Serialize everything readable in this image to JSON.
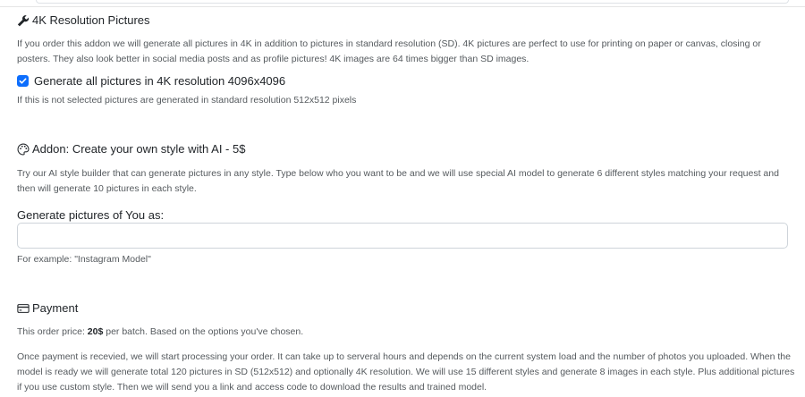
{
  "sections": {
    "hd4k": {
      "title": "4K Resolution Pictures",
      "icon": "wrench-icon",
      "description": "If you order this addon we will generate all pictures in 4K in addition to pictures in standard resolution (SD). 4K pictures are perfect to use for printing on paper or canvas, closing or posters. They also look better in social media posts and as profile pictures! 4K images are 64 times bigger than SD images.",
      "checkbox_label": "Generate all pictures in 4K resolution 4096x4096",
      "checkbox_checked": true,
      "hint": "If this is not selected pictures are generated in standard resolution 512x512 pixels"
    },
    "custom_style": {
      "title": "Addon: Create your own style with AI - 5$",
      "icon": "palette-icon",
      "description": "Try our AI style builder that can generate pictures in any style. Type below who you want to be and we will use special AI model to generate 6 different styles matching your request and then will generate 10 pictures in each style.",
      "input_label": "Generate pictures of You as:",
      "input_value": "",
      "input_placeholder": "",
      "hint": "For example: \"Instagram Model\""
    },
    "payment": {
      "title": "Payment",
      "icon": "credit-card-icon",
      "price_prefix": "This order price: ",
      "price": "20$",
      "price_suffix": " per batch. Based on the options you've chosen.",
      "details": "Once payment is recevied, we will start processing your order. It can take up to serveral hours and depends on the current system load and the number of photos you uploaded. When the model is ready we will generate total 120 pictures in SD (512x512) and optionally 4K resolution. We will use 15 different styles and generate 8 images in each style. Plus additional pictures if you use custom style. Then we will send you a link and access code to download the results and trained model."
    }
  },
  "colors": {
    "accent": "#0d6efd",
    "text": "#212529",
    "muted": "#555a5e",
    "border": "#ced4da"
  }
}
